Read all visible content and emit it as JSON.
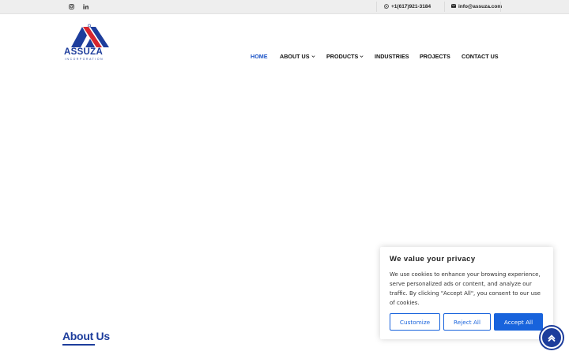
{
  "topbar": {
    "social": [
      {
        "icon": "instagram-icon"
      },
      {
        "icon": "linkedin-icon"
      }
    ],
    "phone": {
      "icon": "whatsapp-icon",
      "text": "+1(617)921-3184"
    },
    "email": {
      "icon": "envelope-icon",
      "text": "info@assuza.com"
    }
  },
  "logo": {
    "word": "ASSUZA",
    "sub": "INCORPORATION",
    "colors": {
      "blue": "#1d3d9c",
      "red": "#d7262e"
    }
  },
  "nav": {
    "items": [
      {
        "label": "HOME",
        "active": true
      },
      {
        "label": "ABOUT US",
        "dropdown": true
      },
      {
        "label": "PRODUCTS",
        "dropdown": true
      },
      {
        "label": "INDUSTRIES"
      },
      {
        "label": "PROJECTS"
      },
      {
        "label": "CONTACT US"
      }
    ],
    "active_color": "#1e56c7"
  },
  "about": {
    "title": "About Us"
  },
  "cookie_banner": {
    "title": "We value your privacy",
    "body": "We use cookies to enhance your browsing experience, serve personalized ads or content, and analyze our traffic. By clicking \"Accept All\", you consent to our use of cookies.",
    "buttons": {
      "customize": "Customize",
      "reject": "Reject All",
      "accept": "Accept All"
    },
    "accent": "#1863dc"
  },
  "scroll_top": {
    "icon": "chevron-up-icon"
  }
}
